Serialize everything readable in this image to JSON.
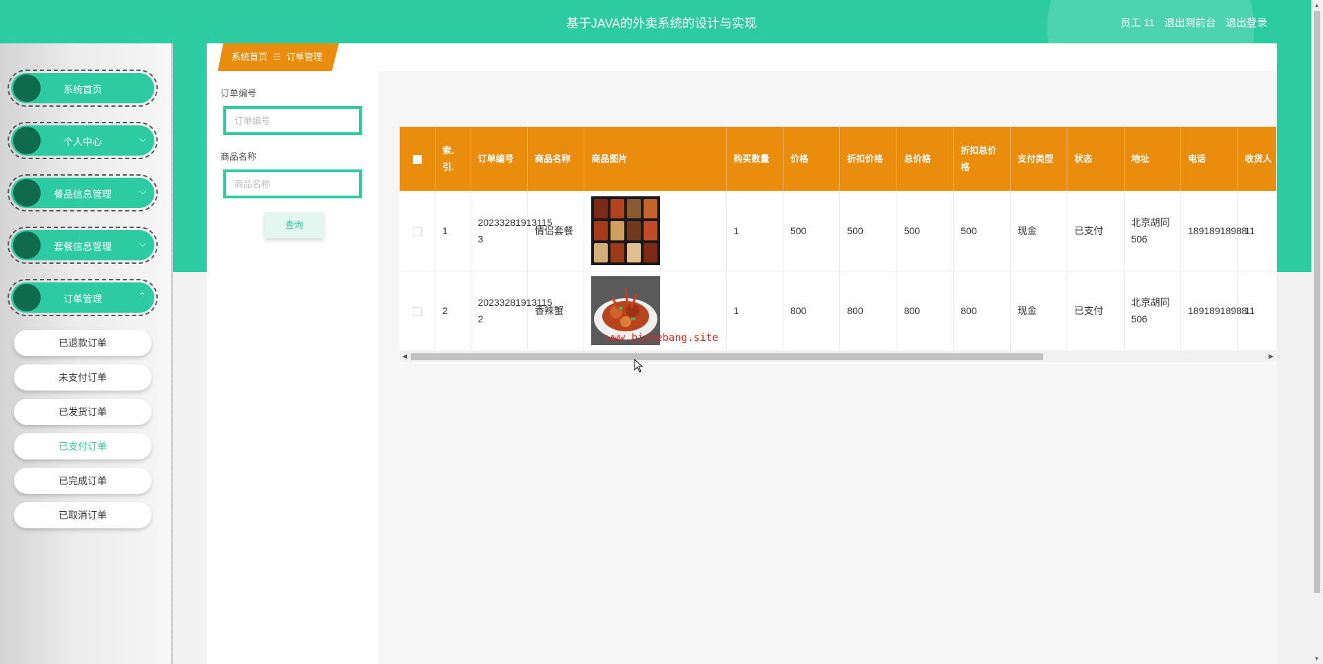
{
  "header": {
    "title": "基于JAVA的外卖系统的设计与实现",
    "user_label": "员工 11",
    "back_to_front": "退出到前台",
    "logout": "退出登录"
  },
  "sidebar": {
    "items": [
      {
        "label": "系统首页",
        "expandable": false
      },
      {
        "label": "个人中心",
        "expandable": true,
        "chevron": "chevron-down-icon"
      },
      {
        "label": "餐品信息管理",
        "expandable": true,
        "chevron": "chevron-down-icon"
      },
      {
        "label": "套餐信息管理",
        "expandable": true,
        "chevron": "chevron-down-icon"
      },
      {
        "label": "订单管理",
        "expandable": true,
        "chevron": "chevron-up-icon"
      }
    ],
    "submenu": [
      "已退款订单",
      "未支付订单",
      "已发货订单",
      "已支付订单",
      "已完成订单",
      "已取消订单"
    ],
    "active_submenu": "已支付订单"
  },
  "breadcrumb": {
    "home": "系统首页",
    "separator": "☰",
    "current": "订单管理"
  },
  "search": {
    "order_no_label": "订单编号",
    "order_no_placeholder": "订单编号",
    "product_label": "商品名称",
    "product_placeholder": "商品名称",
    "button": "查询"
  },
  "table": {
    "columns": [
      "索引",
      "订单编号",
      "商品名称",
      "商品图片",
      "购买数量",
      "价格",
      "折扣价格",
      "总价格",
      "折扣总价格",
      "支付类型",
      "状态",
      "地址",
      "电话",
      "收货人"
    ],
    "header_display": [
      "索.引.",
      "订单编号",
      "商品名称",
      "商品图片",
      "购买数量",
      "价格",
      "折扣价格",
      "总价格",
      "折扣总价格",
      "支付类型",
      "状态",
      "地址",
      "电话",
      "收货人"
    ],
    "rows": [
      {
        "index": "1",
        "order_no": "20233281913115 3",
        "product": "情侣套餐",
        "image": "food-box-image",
        "qty": "1",
        "price": "500",
        "discount_price": "500",
        "total": "500",
        "discount_total": "500",
        "pay_type": "现金",
        "status": "已支付",
        "address": "北京胡同506",
        "phone": "18918918988",
        "receiver": "11"
      },
      {
        "index": "2",
        "order_no": "20233281913115 2",
        "product": "香辣蟹",
        "image": "spicy-crab-image",
        "qty": "1",
        "price": "800",
        "discount_price": "800",
        "total": "800",
        "discount_total": "800",
        "pay_type": "现金",
        "status": "已支付",
        "address": "北京胡同506",
        "phone": "18918918988",
        "receiver": "11"
      }
    ]
  },
  "watermark": "www.bishebang.site",
  "colors": {
    "primary": "#2ccba1",
    "primary_dark": "#0f6b4b",
    "accent": "#ea8c0c"
  }
}
